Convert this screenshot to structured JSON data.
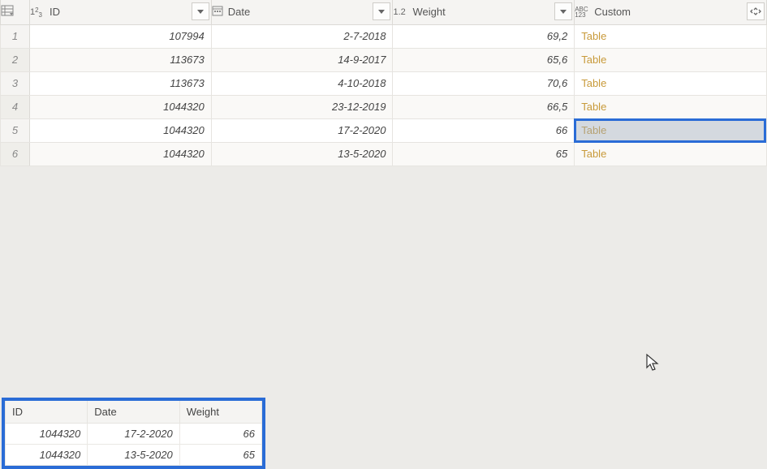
{
  "columns": {
    "id": "ID",
    "date": "Date",
    "weight": "Weight",
    "custom": "Custom"
  },
  "rows": [
    {
      "idx": "1",
      "id": "107994",
      "date": "2-7-2018",
      "weight": "69,2",
      "custom": "Table"
    },
    {
      "idx": "2",
      "id": "113673",
      "date": "14-9-2017",
      "weight": "65,6",
      "custom": "Table"
    },
    {
      "idx": "3",
      "id": "113673",
      "date": "4-10-2018",
      "weight": "70,6",
      "custom": "Table"
    },
    {
      "idx": "4",
      "id": "1044320",
      "date": "23-12-2019",
      "weight": "66,5",
      "custom": "Table"
    },
    {
      "idx": "5",
      "id": "1044320",
      "date": "17-2-2020",
      "weight": "66",
      "custom": "Table",
      "selected": true
    },
    {
      "idx": "6",
      "id": "1044320",
      "date": "13-5-2020",
      "weight": "65",
      "custom": "Table"
    }
  ],
  "preview": {
    "cols": {
      "id": "ID",
      "date": "Date",
      "weight": "Weight"
    },
    "rows": [
      {
        "id": "1044320",
        "date": "17-2-2020",
        "weight": "66"
      },
      {
        "id": "1044320",
        "date": "13-5-2020",
        "weight": "65"
      }
    ]
  }
}
